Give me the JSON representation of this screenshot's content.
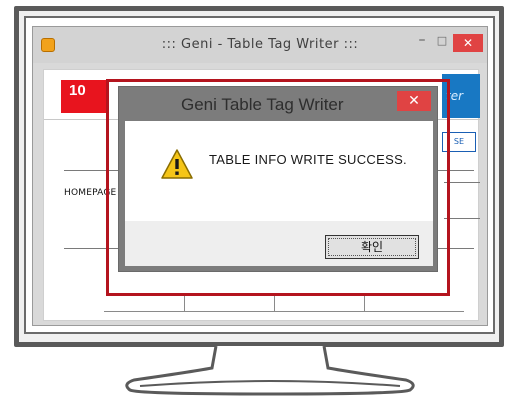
{
  "app_window": {
    "title": "::: Geni - Table Tag Writer :::",
    "minimize": "–",
    "maximize": "□",
    "close": "✕",
    "banner_text": "ter",
    "side_button": "SE",
    "homepage_label": "HOMEPAGE"
  },
  "step_badge": "10",
  "dialog": {
    "title": "Geni Table Tag Writer",
    "close": "✕",
    "message": "TABLE INFO WRITE SUCCESS.",
    "ok_label": "확인",
    "icon": "warning-icon"
  },
  "colors": {
    "highlight": "#b4141e",
    "badge": "#e8141e",
    "close_button": "#e04343",
    "banner": "#1878c3"
  }
}
